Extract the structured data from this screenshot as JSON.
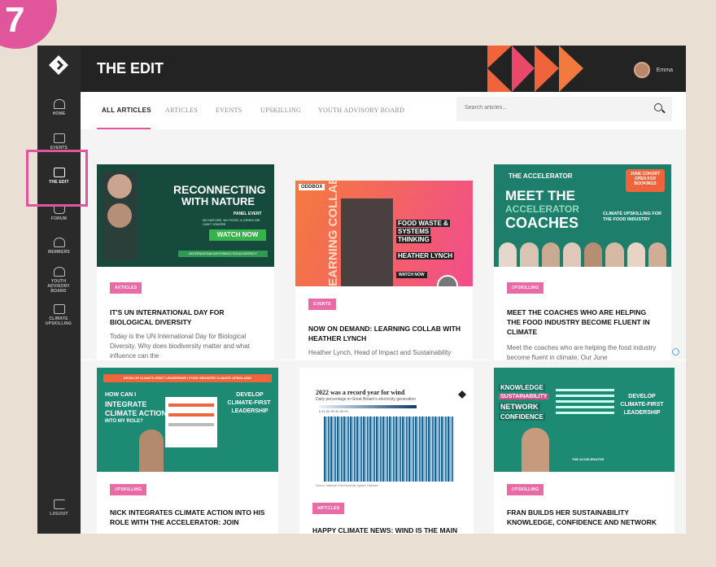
{
  "step": "7",
  "app": {
    "title": "THE EDIT",
    "user_name": "Emma"
  },
  "sidebar": {
    "items": [
      {
        "label": "HOME"
      },
      {
        "label": "EVENTS"
      },
      {
        "label": "THE EDIT"
      },
      {
        "label": "FORUM"
      },
      {
        "label": "MEMBERS"
      },
      {
        "label": "YOUTH ADVISORY BOARD"
      },
      {
        "label": "CLIMATE UPSKILLING"
      },
      {
        "label": "LOGOUT"
      }
    ]
  },
  "tabs": [
    "ALL ARTICLES",
    "ARTICLES",
    "EVENTS",
    "UPSKILLING",
    "YOUTH ADVISORY BOARD"
  ],
  "search": {
    "placeholder": "Search articles..."
  },
  "cards": [
    {
      "tag": "ARTICLES",
      "title": "IT'S UN INTERNATIONAL DAY FOR BIOLOGICAL DIVERSITY",
      "excerpt": "Today is the UN International Day for Biological Diversity. Why does biodiversity matter and what influence can the",
      "thumb": {
        "heading1": "RECONNECTING",
        "heading2": "WITH NATURE",
        "sub": "PANEL EVENT",
        "sub2": "NO NATURE, NO FOOD: A CRISIS WE CAN'T IGNORE",
        "button": "WATCH NOW",
        "hashtag": "#INTERNATIONALDAYFORBIOLOGICALDIVERSITY"
      }
    },
    {
      "tag": "EVENTS",
      "title": "NOW ON DEMAND: LEARNING COLLAB WITH HEATHER LYNCH",
      "excerpt": "Heather Lynch, Head of Impact and Sustainability",
      "thumb": {
        "brand": "ODDBOX",
        "vertical": "LEARNING COLLAB",
        "topic1": "FOOD WASTE &",
        "topic2": "SYSTEMS",
        "topic3": "THINKING",
        "speaker": "HEATHER LYNCH",
        "button": "WATCH NOW"
      }
    },
    {
      "tag": "UPSKILLING",
      "title": "MEET THE COACHES WHO ARE HELPING THE FOOD INDUSTRY BECOME FLUENT IN CLIMATE",
      "excerpt": "Meet the coaches who are helping the food industry become fluent in climate. Our June",
      "thumb": {
        "program": "THE ACCELERATOR",
        "h1": "MEET THE",
        "h2": "ACCELERATOR",
        "h3": "COACHES",
        "badge": "JUNE COHORT OPEN FOR BOOKINGS",
        "side": "CLIMATE UPSKILLING FOR THE FOOD INDUSTRY"
      }
    },
    {
      "tag": "UPSKILLING",
      "title": "NICK INTEGRATES CLIMATE ACTION INTO HIS ROLE WITH THE ACCELERATOR: JOIN",
      "excerpt": "",
      "thumb": {
        "banner": "DEVELOP CLIMATE-FIRST LEADERSHIP | FOOD INDUSTRY CLIMATE UPSKILLING",
        "q1": "HOW CAN I",
        "q2": "INTEGRATE",
        "q3": "CLIMATE ACTION",
        "q4": "INTO MY ROLE?",
        "right1": "DEVELOP",
        "right2": "CLIMATE-FIRST",
        "right3": "LEADERSHIP"
      }
    },
    {
      "tag": "ARTICLES",
      "title": "HAPPY CLIMATE NEWS: WIND IS THE MAIN",
      "excerpt": "",
      "thumb": {
        "chart_title": "2022 was a record year for wind",
        "chart_sub": "Daily percentage in Great Britain's electricity generation",
        "scale": "0   10   20   30   40   50+%",
        "source": "Source: National Grid Electricity System Operator"
      }
    },
    {
      "tag": "UPSKILLING",
      "title": "FRAN BUILDS HER SUSTAINABILITY KNOWLEDGE, CONFIDENCE AND NETWORK",
      "excerpt": "",
      "thumb": {
        "w1": "KNOWLEDGE",
        "w2": "SUSTAINABILITY",
        "w3": "NETWORK",
        "w4": "CONFIDENCE",
        "right1": "DEVELOP",
        "right2": "CLIMATE-FIRST",
        "right3": "LEADERSHIP",
        "program": "THE ACCELERATOR"
      }
    }
  ],
  "colors": {
    "accent_pink": "#e0559b",
    "teal": "#1f8a72",
    "orange": "#f0643c",
    "sidebar": "#2a2a2a"
  }
}
